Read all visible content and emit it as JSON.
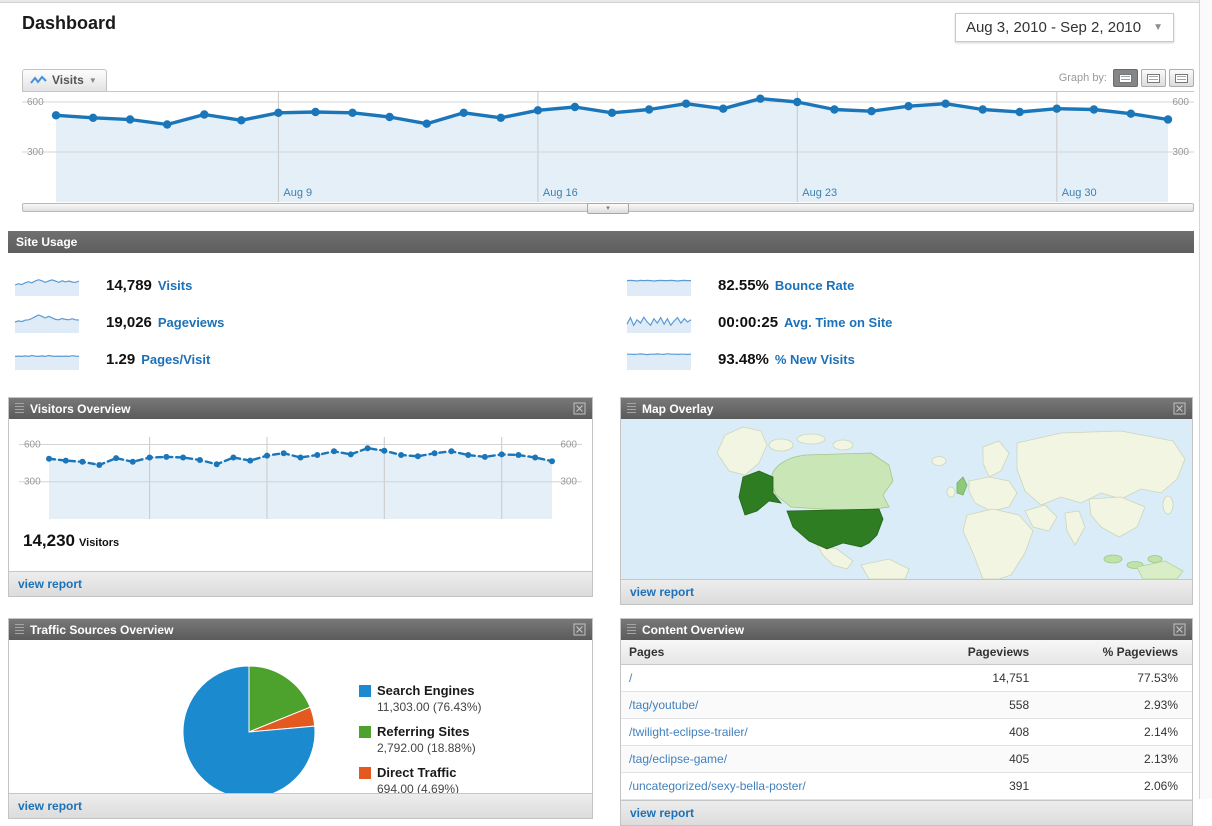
{
  "page": {
    "title": "Dashboard",
    "date_range": "Aug 3, 2010 - Sep 2, 2010"
  },
  "timeline": {
    "metric_tab": "Visits",
    "graph_by_label": "Graph by:",
    "y_ticks": [
      "600",
      "300"
    ],
    "x_labels": [
      "Aug 9",
      "Aug 16",
      "Aug 23",
      "Aug 30"
    ]
  },
  "site_usage": {
    "header": "Site Usage",
    "metrics": [
      {
        "value": "14,789",
        "label": "Visits",
        "spark": [
          5,
          5.6,
          5.2,
          6,
          6.5,
          6,
          6.8,
          7.4,
          6.9,
          6.2,
          6.8,
          7.3,
          6.8,
          6.2,
          6.9,
          6.4,
          6.8,
          6.3,
          6.2,
          6.8
        ]
      },
      {
        "value": "19,026",
        "label": "Pageviews",
        "spark": [
          5,
          5.5,
          5.2,
          5.8,
          6,
          6.6,
          7.4,
          8.2,
          7.6,
          6.8,
          7.6,
          6.9,
          6.2,
          6,
          6.6,
          6.2,
          6,
          6.5,
          6,
          5.9
        ]
      },
      {
        "value": "1.29",
        "label": "Pages/Visit",
        "spark": [
          6.2,
          6.3,
          6.2,
          6.4,
          6.2,
          6.6,
          6.3,
          6.2,
          6.4,
          6.2,
          6.6,
          6.3,
          6.2,
          6.3,
          6.2,
          6.3,
          6.2,
          6.5,
          6.3,
          6.2
        ]
      },
      {
        "value": "82.55%",
        "label": "Bounce Rate",
        "spark": [
          7,
          7.1,
          7,
          6.8,
          7.1,
          7,
          7.1,
          7,
          6.8,
          7,
          7.1,
          7,
          7,
          7.1,
          7,
          6.8,
          7,
          7.1,
          7,
          7
        ]
      },
      {
        "value": "00:00:25",
        "label": "Avg. Time on Site",
        "spark": [
          4,
          7,
          3.5,
          6,
          4.5,
          7.2,
          5,
          3.5,
          6.5,
          4.5,
          7,
          4,
          6.5,
          3.5,
          5.5,
          7,
          4.5,
          6.5,
          5,
          6
        ]
      },
      {
        "value": "93.48%",
        "label": "% New Visits",
        "spark": [
          7.2,
          7.2,
          7.1,
          7.2,
          7.3,
          7.2,
          7,
          7.2,
          7.2,
          7.3,
          7.2,
          7.1,
          7.4,
          7.2,
          7.2,
          7.1,
          7.2,
          7.2,
          7.1,
          7.2
        ]
      }
    ]
  },
  "panels": {
    "visitors": {
      "title": "Visitors Overview",
      "value": "14,230",
      "value_label": "Visitors",
      "footer_link": "view report"
    },
    "map": {
      "title": "Map Overlay",
      "footer_link": "view report"
    },
    "traffic": {
      "title": "Traffic Sources Overview",
      "footer_link": "view report"
    },
    "content": {
      "title": "Content Overview",
      "columns": [
        "Pages",
        "Pageviews",
        "% Pageviews"
      ],
      "rows": [
        [
          "/",
          "14,751",
          "77.53%"
        ],
        [
          "/tag/youtube/",
          "558",
          "2.93%"
        ],
        [
          "/twilight-eclipse-trailer/",
          "408",
          "2.14%"
        ],
        [
          "/tag/eclipse-game/",
          "405",
          "2.13%"
        ],
        [
          "/uncategorized/sexy-bella-poster/",
          "391",
          "2.06%"
        ]
      ],
      "footer_link": "view report"
    }
  },
  "chart_data": [
    {
      "type": "line",
      "name": "visits-timeline",
      "title": "Visits (Aug 3, 2010 - Sep 2, 2010)",
      "x": [
        "Aug 3",
        "Aug 4",
        "Aug 5",
        "Aug 6",
        "Aug 7",
        "Aug 8",
        "Aug 9",
        "Aug 10",
        "Aug 11",
        "Aug 12",
        "Aug 13",
        "Aug 14",
        "Aug 15",
        "Aug 16",
        "Aug 17",
        "Aug 18",
        "Aug 19",
        "Aug 20",
        "Aug 21",
        "Aug 22",
        "Aug 23",
        "Aug 24",
        "Aug 25",
        "Aug 26",
        "Aug 27",
        "Aug 28",
        "Aug 29",
        "Aug 30",
        "Aug 31",
        "Sep 1",
        "Sep 2"
      ],
      "values": [
        520,
        505,
        495,
        465,
        525,
        490,
        535,
        540,
        535,
        510,
        470,
        535,
        505,
        550,
        570,
        535,
        555,
        590,
        560,
        620,
        600,
        555,
        545,
        575,
        590,
        555,
        540,
        560,
        555,
        530,
        495
      ],
      "ylim": [
        0,
        660
      ],
      "yticks": [
        {
          "value": 600,
          "label": "600"
        },
        {
          "value": 300,
          "label": "300"
        }
      ],
      "x_gridline_labels": [
        {
          "index": 6,
          "label": "Aug 9"
        },
        {
          "index": 13,
          "label": "Aug 16"
        },
        {
          "index": 20,
          "label": "Aug 23"
        },
        {
          "index": 27,
          "label": "Aug 30"
        }
      ],
      "color": "#1b76b9",
      "fill": "#e4eff8",
      "grid": true,
      "legend_position": "none"
    },
    {
      "type": "line",
      "name": "visitors-overview",
      "title": "Visitors",
      "x": [
        "Aug 3",
        "Aug 4",
        "Aug 5",
        "Aug 6",
        "Aug 7",
        "Aug 8",
        "Aug 9",
        "Aug 10",
        "Aug 11",
        "Aug 12",
        "Aug 13",
        "Aug 14",
        "Aug 15",
        "Aug 16",
        "Aug 17",
        "Aug 18",
        "Aug 19",
        "Aug 20",
        "Aug 21",
        "Aug 22",
        "Aug 23",
        "Aug 24",
        "Aug 25",
        "Aug 26",
        "Aug 27",
        "Aug 28",
        "Aug 29",
        "Aug 30",
        "Aug 31",
        "Sep 1",
        "Sep 2"
      ],
      "values": [
        485,
        470,
        460,
        435,
        490,
        460,
        495,
        500,
        495,
        475,
        440,
        495,
        470,
        510,
        530,
        495,
        515,
        545,
        520,
        570,
        550,
        515,
        505,
        530,
        545,
        515,
        500,
        520,
        515,
        495,
        465
      ],
      "ylim": [
        0,
        660
      ],
      "yticks": [
        {
          "value": 600,
          "label": "600"
        },
        {
          "value": 300,
          "label": "300"
        }
      ],
      "x_gridline_labels": [
        {
          "index": 6
        },
        {
          "index": 13
        },
        {
          "index": 20
        },
        {
          "index": 27
        }
      ],
      "color": "#1b76b9",
      "fill": "#e4eff8",
      "grid": true,
      "legend_position": "none"
    },
    {
      "type": "pie",
      "name": "traffic-sources",
      "title": "Traffic Sources Overview",
      "slices": [
        {
          "label": "Search Engines",
          "value": 11303.0,
          "percent": 76.43,
          "display": "11,303.00 (76.43%)",
          "color": "#1b8ace"
        },
        {
          "label": "Referring Sites",
          "value": 2792.0,
          "percent": 18.88,
          "display": "2,792.00 (18.88%)",
          "color": "#4ca22c"
        },
        {
          "label": "Direct Traffic",
          "value": 694.0,
          "percent": 4.69,
          "display": "694.00 (4.69%)",
          "color": "#e4591f"
        }
      ],
      "legend_position": "right"
    }
  ],
  "colors": {
    "header_bar": "#666666",
    "link_blue": "#1c71b8",
    "chart_line": "#1b76b9",
    "chart_fill": "#e4eff8",
    "map_ocean": "#d9ecf8",
    "map_country_high": "#2e7d22",
    "map_country_mid": "#c9e6b6",
    "map_country_low": "#f1f5e2"
  }
}
